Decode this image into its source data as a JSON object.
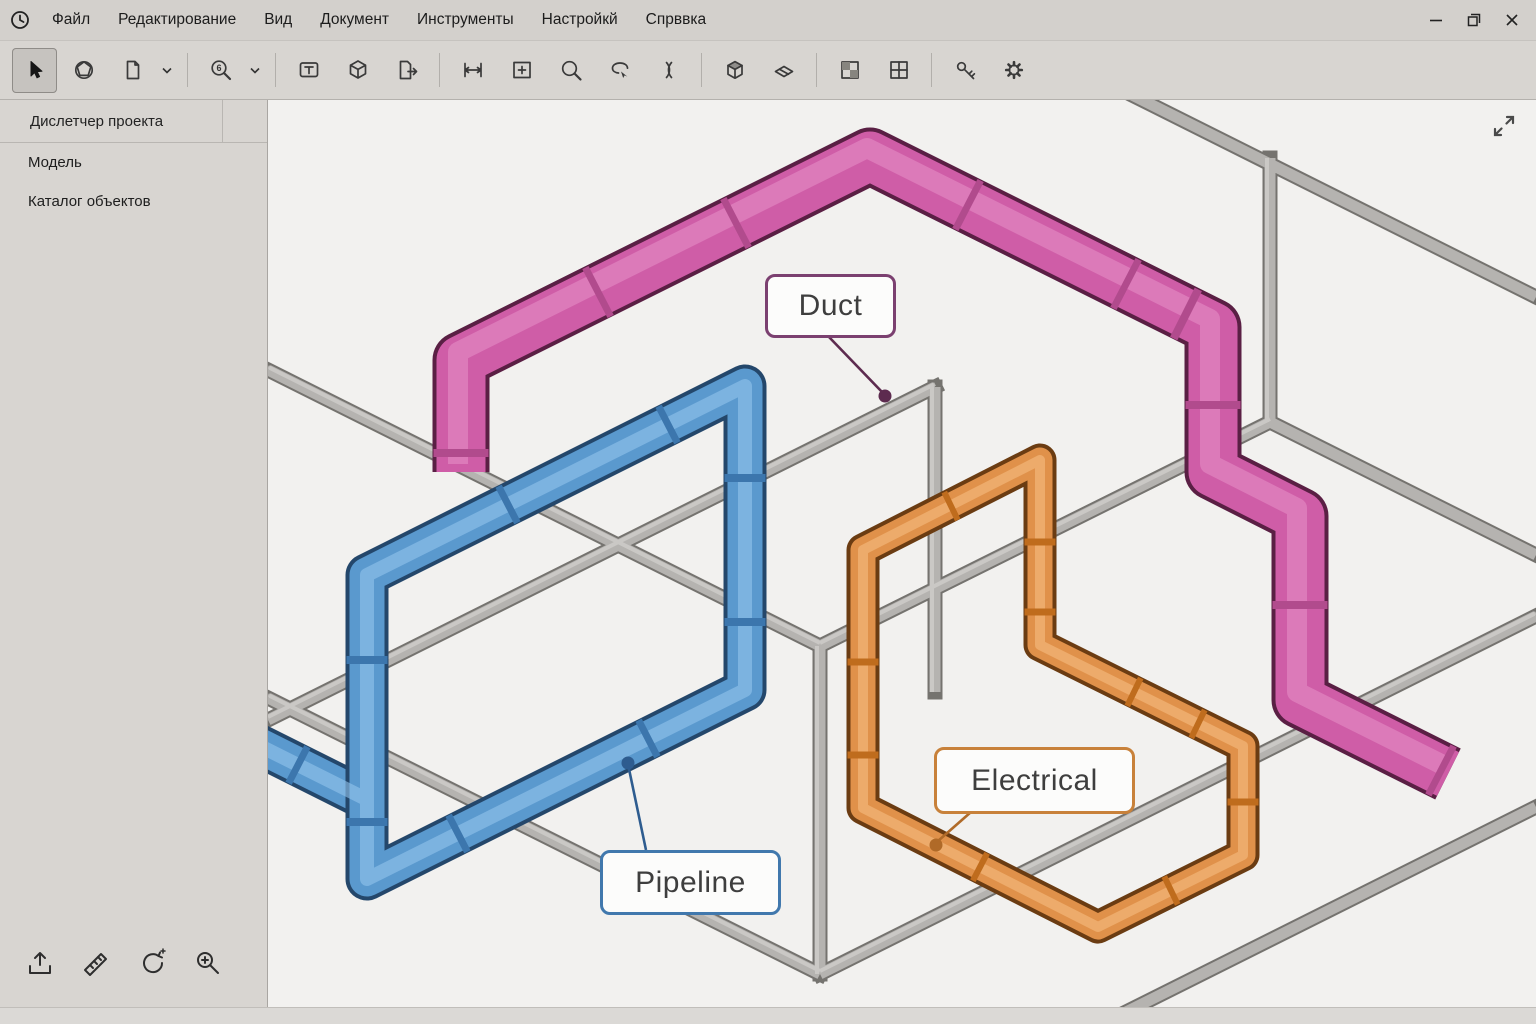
{
  "menubar": {
    "items": [
      "Файл",
      "Редактирование",
      "Вид",
      "Документ",
      "Инструменты",
      "Настройкй",
      "Спрввка"
    ]
  },
  "toolbar": {
    "zoom_level": "6",
    "tools": [
      "select",
      "shaded-view",
      "new-document",
      "zoom",
      "text-frame",
      "cube",
      "export-page",
      "dimension",
      "add-frame",
      "search",
      "lasso",
      "double-curve",
      "box-3d",
      "section-plane",
      "checker",
      "grid",
      "key",
      "settings"
    ]
  },
  "sidebar": {
    "title": "Дислетчер проекта",
    "items": [
      "Модель",
      "Каталог объектов"
    ],
    "tools": [
      "export",
      "measure",
      "orbit",
      "zoom-window"
    ]
  },
  "viewport": {
    "labels": [
      {
        "text": "Duct",
        "accent": "#7b4070",
        "leader": "#5d2b4f"
      },
      {
        "text": "Pipeline",
        "accent": "#4178ad",
        "leader": "#2e5c8f"
      },
      {
        "text": "Electrical",
        "accent": "#c8813a",
        "leader": "#b06a28"
      }
    ],
    "colors": {
      "background": "#f2f1ef",
      "structure": "#b5b3b0",
      "structure_outline": "#75736f",
      "duct": "#cf5da7",
      "duct_outline": "#5a1f44",
      "pipeline": "#5a99ce",
      "pipeline_outline": "#24476b",
      "electrical": "#e0914a",
      "electrical_outline": "#6b3c12"
    }
  }
}
